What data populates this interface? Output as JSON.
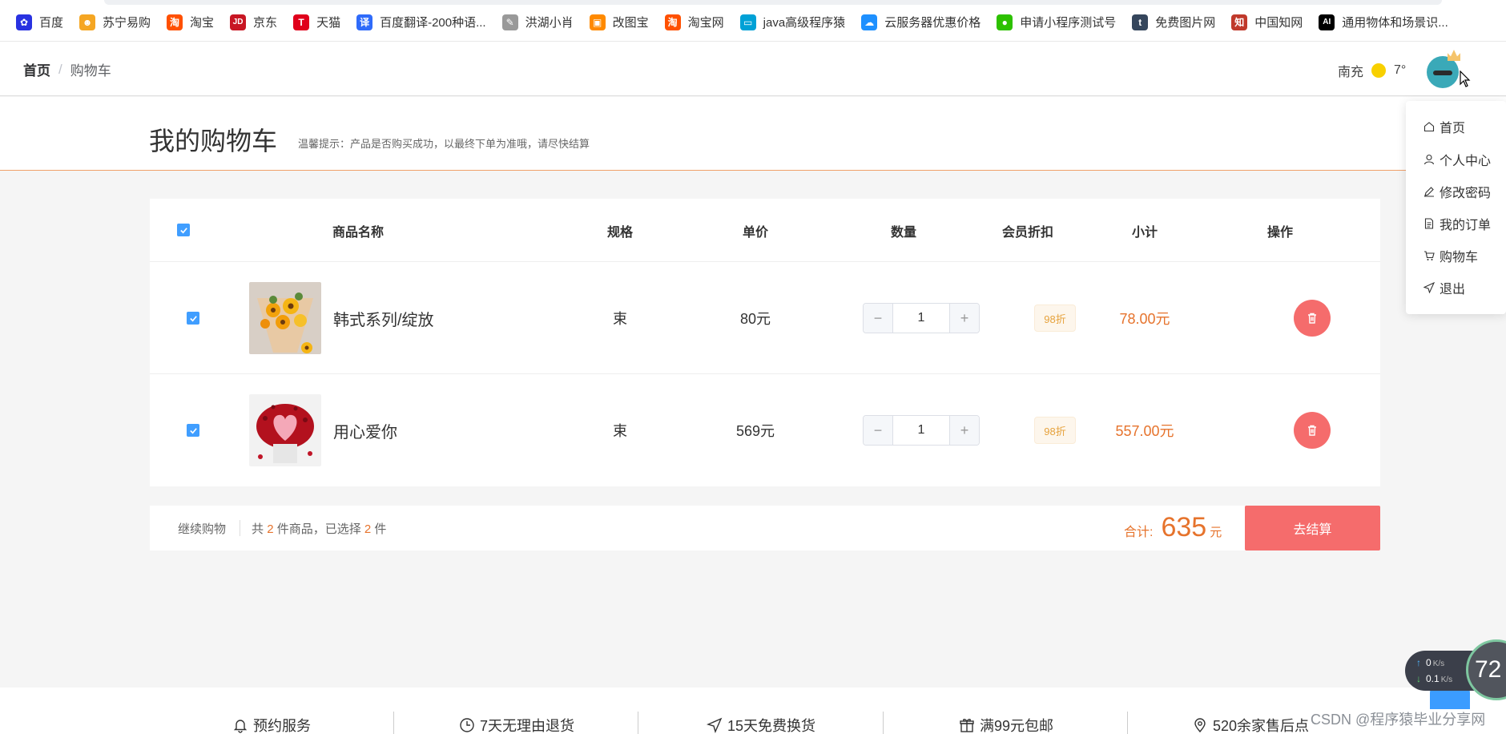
{
  "bookmarks": [
    {
      "label": "百度",
      "icon": "baidu-paw-icon",
      "color": "#2932e1",
      "glyph": "✿"
    },
    {
      "label": "苏宁易购",
      "icon": "suning-lion-icon",
      "color": "#f5a623",
      "glyph": "☻"
    },
    {
      "label": "淘宝",
      "icon": "taobao-icon",
      "color": "#ff5000",
      "glyph": "淘"
    },
    {
      "label": "京东",
      "icon": "jd-icon",
      "color": "#c81623",
      "glyph": "JD"
    },
    {
      "label": "天猫",
      "icon": "tmall-icon",
      "color": "#e0001b",
      "glyph": "T"
    },
    {
      "label": "百度翻译-200种语...",
      "icon": "baidu-translate-icon",
      "color": "#2f6bfa",
      "glyph": "译"
    },
    {
      "label": "洪湖小肖",
      "icon": "feather-icon",
      "color": "#999999",
      "glyph": "✎"
    },
    {
      "label": "改图宝",
      "icon": "gaitubao-icon",
      "color": "#ff8a00",
      "glyph": "▣"
    },
    {
      "label": "淘宝网",
      "icon": "taobao-icon",
      "color": "#ff5000",
      "glyph": "淘"
    },
    {
      "label": "java高级程序猿",
      "icon": "bilibili-tv-icon",
      "color": "#00a1d6",
      "glyph": "▭"
    },
    {
      "label": "云服务器优惠价格",
      "icon": "cloud-icon",
      "color": "#1e90ff",
      "glyph": "☁"
    },
    {
      "label": "申请小程序测试号",
      "icon": "wechat-icon",
      "color": "#2dc100",
      "glyph": "●"
    },
    {
      "label": "免费图片网",
      "icon": "tumblr-icon",
      "color": "#35465c",
      "glyph": "t"
    },
    {
      "label": "中国知网",
      "icon": "cnki-icon",
      "color": "#c0392b",
      "glyph": "知"
    },
    {
      "label": "通用物体和场景识...",
      "icon": "ai-icon",
      "color": "#000000",
      "glyph": "AI"
    }
  ],
  "header": {
    "breadcrumb_home": "首页",
    "breadcrumb_sep": "/",
    "breadcrumb_current": "购物车",
    "city": "南充",
    "temperature": "7°"
  },
  "page": {
    "title": "我的购物车",
    "tip": "温馨提示：产品是否购买成功，以最终下单为准哦，请尽快结算"
  },
  "table": {
    "headers": [
      "商品名称",
      "规格",
      "单价",
      "数量",
      "会员折扣",
      "小计",
      "操作"
    ],
    "items": [
      {
        "name": "韩式系列/绽放",
        "spec": "束",
        "price": "80元",
        "quantity": "1",
        "discount": "98折",
        "subtotal": "78.00元"
      },
      {
        "name": "用心爱你",
        "spec": "束",
        "price": "569元",
        "quantity": "1",
        "discount": "98折",
        "subtotal": "557.00元"
      }
    ]
  },
  "summary": {
    "continue_label": "继续购物",
    "count_prefix": "共",
    "total_count": "2",
    "count_mid": "件商品，已选择",
    "selected_count": "2",
    "count_suffix": "件",
    "total_label": "合计:",
    "total_amount": "635",
    "total_unit": "元",
    "checkout_label": "去结算"
  },
  "services": [
    {
      "label": "预约服务",
      "icon": "bell-icon"
    },
    {
      "label": "7天无理由退货",
      "icon": "clock-icon"
    },
    {
      "label": "15天免费换货",
      "icon": "send-icon"
    },
    {
      "label": "满99元包邮",
      "icon": "gift-icon"
    },
    {
      "label": "520余家售后点",
      "icon": "location-icon"
    }
  ],
  "dropdown": [
    {
      "label": "首页",
      "icon": "home-icon"
    },
    {
      "label": "个人中心",
      "icon": "user-icon"
    },
    {
      "label": "修改密码",
      "icon": "edit-icon"
    },
    {
      "label": "我的订单",
      "icon": "document-icon"
    },
    {
      "label": "购物车",
      "icon": "cart-icon"
    },
    {
      "label": "退出",
      "icon": "logout-icon"
    }
  ],
  "network": {
    "up": "0",
    "down": "0.1",
    "unit": "K/s",
    "gauge": "72"
  },
  "watermark": "CSDN @程序猿毕业分享网",
  "colors": {
    "accent": "#409eff",
    "danger": "#f56c6c",
    "price": "#e6732c",
    "discount_bg": "#fdf6ec"
  }
}
